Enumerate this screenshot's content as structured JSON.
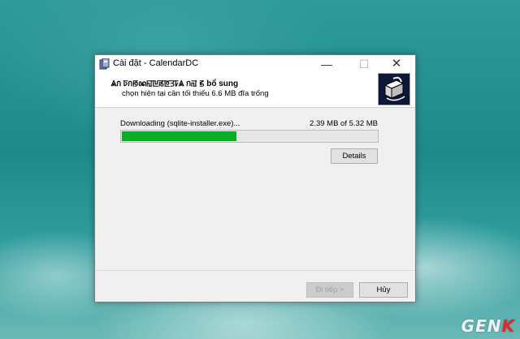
{
  "window": {
    "title": "Cài đặt - CalendarDC",
    "controls": {
      "minimize": "—",
      "maximize": "☐",
      "close": "✕"
    }
  },
  "header": {
    "title": "ꥃก ꠑกꡐꦤꡎꡖꡏꡔꡗꡠꥃ กꡌ ꡝ bổ sung",
    "subtitle": "chọn hiện tại cần tối thiểu 6.6 MB đĩa trống",
    "logo_icon": "installer-box-icon"
  },
  "progress": {
    "status": "Downloading (sqlite-installer.exe)...",
    "size": "2.39 MB of 5.32 MB",
    "fraction": 0.45,
    "color": "#06b025"
  },
  "buttons": {
    "details": "Details",
    "next": "Đi tiếp >",
    "cancel": "Hủy"
  },
  "watermark": {
    "text": "GEN",
    "accent": "K"
  }
}
